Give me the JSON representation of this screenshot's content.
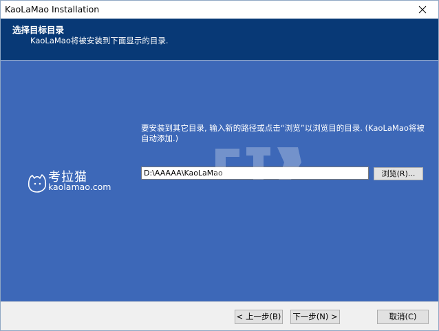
{
  "window": {
    "title": "KaoLaMao Installation",
    "close_icon": "close-icon"
  },
  "banner": {
    "title": "选择目标目录",
    "subtitle": "KaoLaMao将被安装到下面显示的目录."
  },
  "logo": {
    "name": "考拉猫",
    "domain": "kaolamao.com"
  },
  "main": {
    "instructions": "要安装到其它目录, 输入新的路径或点击“浏览”以浏览目的目录. (KaoLaMao将被自动添加.)",
    "path_value": "D:\\AAAAA\\KaoLaMao",
    "browse_label": "浏览(R)..."
  },
  "buttons": {
    "back_label": "< 上一步(B)",
    "next_label": "下一步(N) >",
    "cancel_label": "取消(C)"
  },
  "colors": {
    "banner": "#083976",
    "main": "#3d68b8"
  }
}
